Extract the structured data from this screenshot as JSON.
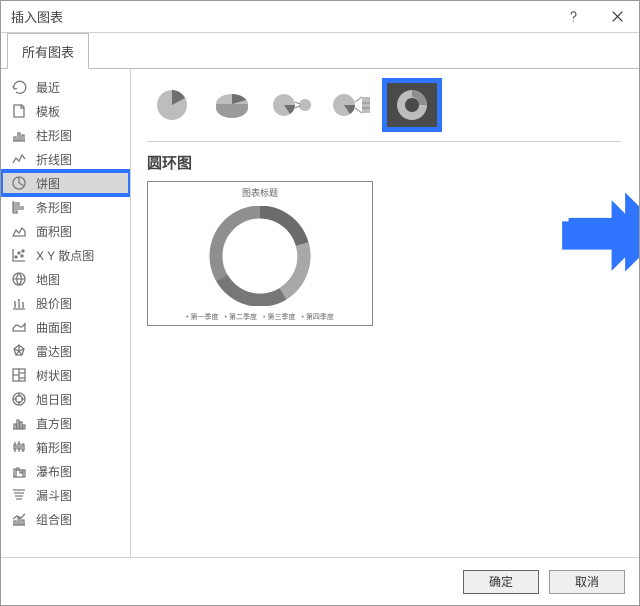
{
  "dialog": {
    "title": "插入图表"
  },
  "tabs": {
    "all": "所有图表"
  },
  "sidebar": {
    "items": [
      {
        "label": "最近"
      },
      {
        "label": "模板"
      },
      {
        "label": "柱形图"
      },
      {
        "label": "折线图"
      },
      {
        "label": "饼图"
      },
      {
        "label": "条形图"
      },
      {
        "label": "面积图"
      },
      {
        "label": "X Y 散点图"
      },
      {
        "label": "地图"
      },
      {
        "label": "股价图"
      },
      {
        "label": "曲面图"
      },
      {
        "label": "雷达图"
      },
      {
        "label": "树状图"
      },
      {
        "label": "旭日图"
      },
      {
        "label": "直方图"
      },
      {
        "label": "箱形图"
      },
      {
        "label": "瀑布图"
      },
      {
        "label": "漏斗图"
      },
      {
        "label": "组合图"
      }
    ]
  },
  "subtype_heading": "圆环图",
  "preview": {
    "title": "图表标题",
    "legend": [
      "第一季度",
      "第二季度",
      "第三季度",
      "第四季度"
    ]
  },
  "buttons": {
    "ok": "确定",
    "cancel": "取消"
  },
  "colors": {
    "highlight": "#2f75ff"
  }
}
